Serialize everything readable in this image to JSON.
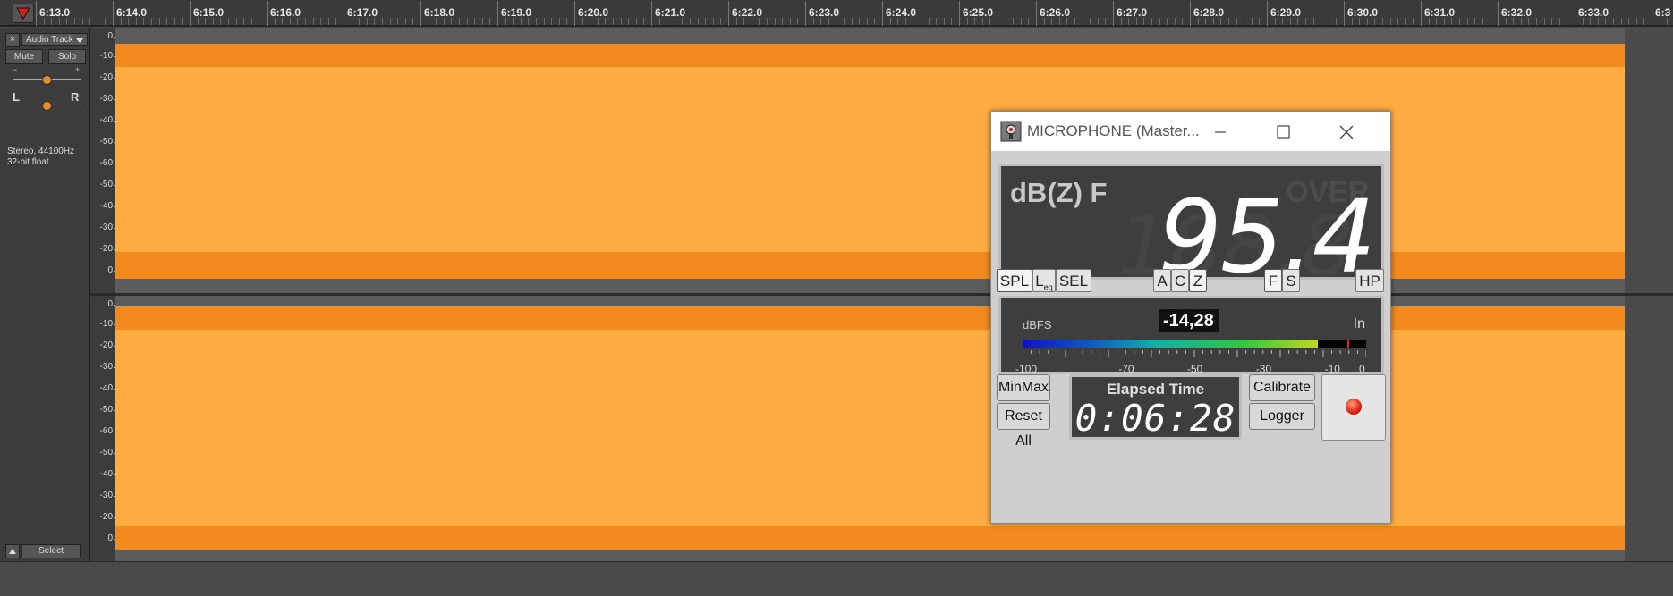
{
  "ruler": {
    "ticks": [
      "6:13.0",
      "6:14.0",
      "6:15.0",
      "6:16.0",
      "6:17.0",
      "6:18.0",
      "6:19.0",
      "6:20.0",
      "6:21.0",
      "6:22.0",
      "6:23.0",
      "6:24.0",
      "6:25.0",
      "6:26.0",
      "6:27.0",
      "6:28.0",
      "6:29.0",
      "6:30.0",
      "6:31.0",
      "6:32.0",
      "6:33.0",
      "6:3"
    ]
  },
  "track": {
    "close": "×",
    "name": "Audio Track",
    "mute": "Mute",
    "solo": "Solo",
    "gain_minus": "−",
    "gain_plus": "+",
    "pan_left": "L",
    "pan_right": "R",
    "info_line1": "Stereo, 44100Hz",
    "info_line2": "32-bit float",
    "select": "Select"
  },
  "db_scale": {
    "labels": [
      "0",
      "-10",
      "-20",
      "-30",
      "-40",
      "-50",
      "-60",
      "-50",
      "-40",
      "-30",
      "-20",
      "0"
    ]
  },
  "meter": {
    "title": "MICROPHONE (Master...",
    "weighting": "dB(Z) F",
    "over": "OVER",
    "ghost": "188.8",
    "value": "95.4",
    "buttons": {
      "spl": "SPL",
      "leq": "L",
      "leq_sub": "eq",
      "sel": "SEL",
      "a": "A",
      "c": "C",
      "z": "Z",
      "f": "F",
      "s": "S",
      "hp": "HP"
    },
    "dbfs_label": "dBFS",
    "peak_value": "-14,28",
    "input_label": "In",
    "level_fraction": 0.86,
    "peak_fraction": 0.945,
    "scale": [
      "-100",
      "-70",
      "-50",
      "-30",
      "-10",
      "0"
    ],
    "minmax": "MinMax",
    "reset_all": "Reset All",
    "elapsed_label": "Elapsed Time",
    "elapsed_value": "0:06:28",
    "calibrate": "Calibrate",
    "logger": "Logger"
  },
  "colors": {
    "waveform_peak": "#f28a1d",
    "waveform_rms": "#ffad42",
    "record": "#e02010"
  }
}
